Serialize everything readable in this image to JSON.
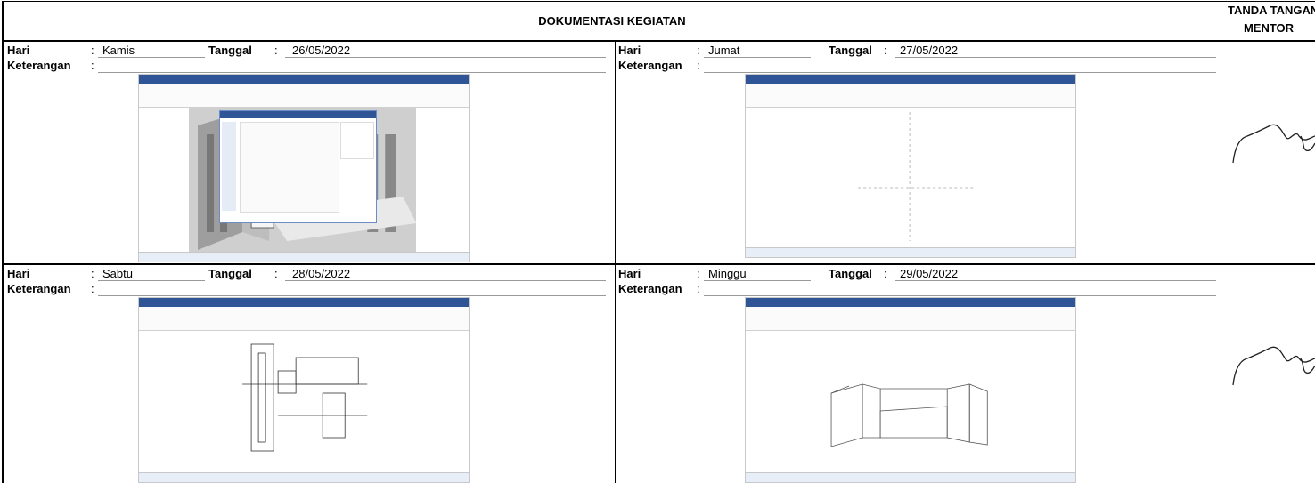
{
  "header": {
    "title": "DOKUMENTASI KEGIATAN",
    "signature_title_line1": "TANDA TANGAN",
    "signature_title_line2": "MENTOR"
  },
  "labels": {
    "hari": "Hari",
    "tanggal": "Tanggal",
    "keterangan": "Keterangan",
    "colon": ":"
  },
  "entries": [
    {
      "hari": "Kamis",
      "tanggal": "26/05/2022",
      "keterangan": ""
    },
    {
      "hari": "Jumat",
      "tanggal": "27/05/2022",
      "keterangan": ""
    },
    {
      "hari": "Sabtu",
      "tanggal": "28/05/2022",
      "keterangan": ""
    },
    {
      "hari": "Minggu",
      "tanggal": "29/05/2022",
      "keterangan": ""
    }
  ],
  "colors": {
    "ribbon": "#2f5597",
    "grid_line": "#000000"
  }
}
